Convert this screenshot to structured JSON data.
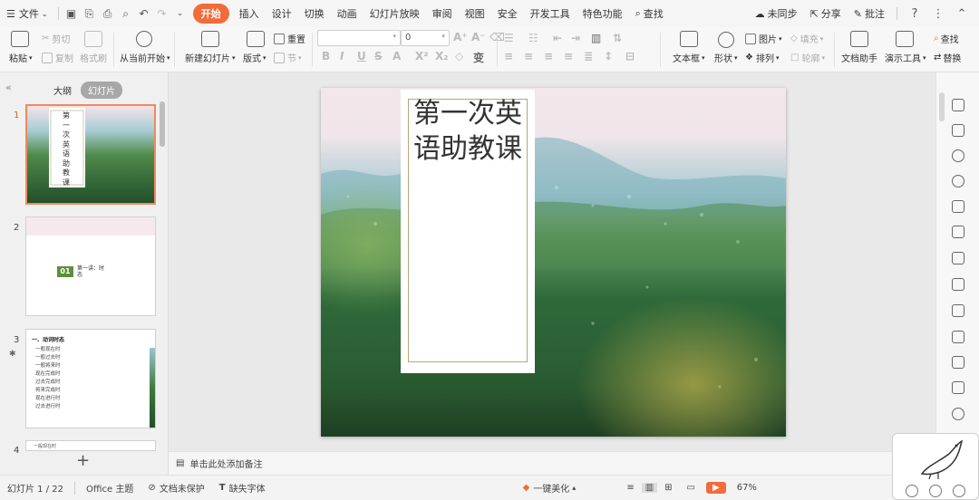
{
  "menu": {
    "file": "文件",
    "tabs": [
      "开始",
      "插入",
      "设计",
      "切换",
      "动画",
      "幻灯片放映",
      "审阅",
      "视图",
      "安全",
      "开发工具",
      "特色功能"
    ],
    "search": "查找",
    "sync": "未同步",
    "share": "分享",
    "comment": "批注"
  },
  "ribbon": {
    "paste": "粘贴",
    "cut": "剪切",
    "copy": "复制",
    "format_painter": "格式刷",
    "from_current": "从当前开始",
    "new_slide": "新建幻灯片",
    "layout": "版式",
    "reset": "重置",
    "section": "节",
    "font_size": "0",
    "text_box": "文本框",
    "shape": "形状",
    "picture": "图片",
    "fill": "填充",
    "arrange": "排列",
    "outline": "轮廓",
    "doc_helper": "文档助手",
    "present_tools": "演示工具",
    "find": "查找",
    "replace": "替换"
  },
  "panel": {
    "outline_tab": "大纲",
    "slides_tab": "幻灯片",
    "thumb_numbers": [
      "1",
      "2",
      "3",
      "4"
    ],
    "thumb2_badge": "01",
    "thumb2_text": "第一讲：时态",
    "thumb3_heading": "一、动词时态",
    "thumb3_items": [
      "一般现在时",
      "一般过去时",
      "一般将来时",
      "现在完成时",
      "过去完成时",
      "将来完成时",
      "现在进行时",
      "过去进行时"
    ],
    "thumb4_text": "一般现在时"
  },
  "slide": {
    "title": "第一次英语助教课"
  },
  "notes": {
    "placeholder": "单击此处添加备注"
  },
  "status": {
    "slide_counter": "幻灯片 1 / 22",
    "theme": "Office 主题",
    "protect": "文档未保护",
    "missing_font": "缺失字体",
    "beautify": "一键美化",
    "zoom": "67%"
  }
}
